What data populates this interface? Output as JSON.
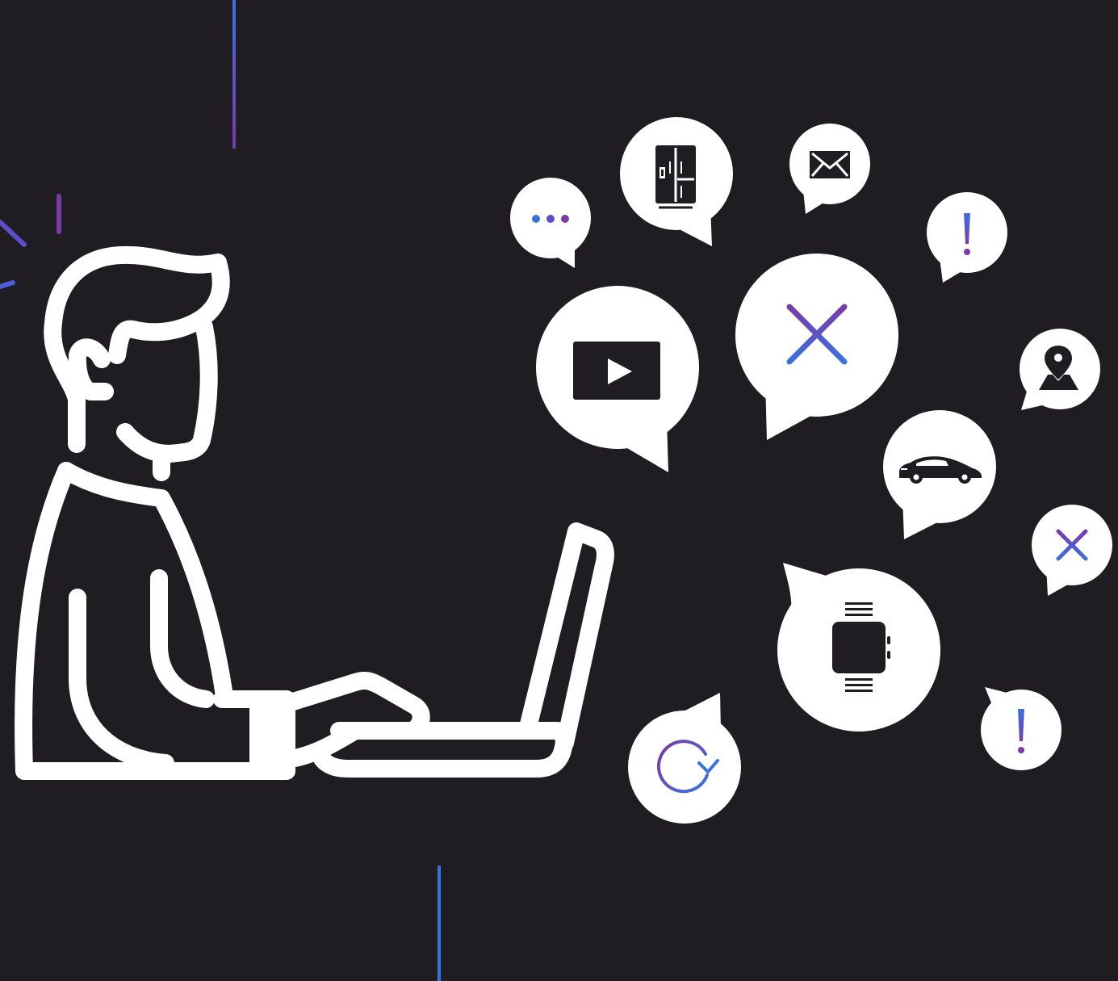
{
  "scene": {
    "background": "#1f1d22",
    "line_color": "#ffffff",
    "accent_purple": "#6a3aa8",
    "accent_blue": "#3a6fd8",
    "figure": "person-at-laptop",
    "bubbles": [
      {
        "icon": "ellipsis-icon"
      },
      {
        "icon": "refrigerator-icon"
      },
      {
        "icon": "envelope-icon"
      },
      {
        "icon": "exclamation-icon"
      },
      {
        "icon": "video-play-icon"
      },
      {
        "icon": "close-x-icon"
      },
      {
        "icon": "map-pin-icon"
      },
      {
        "icon": "car-icon"
      },
      {
        "icon": "close-x-icon"
      },
      {
        "icon": "smartwatch-icon"
      },
      {
        "icon": "refresh-icon"
      },
      {
        "icon": "exclamation-icon"
      }
    ]
  }
}
